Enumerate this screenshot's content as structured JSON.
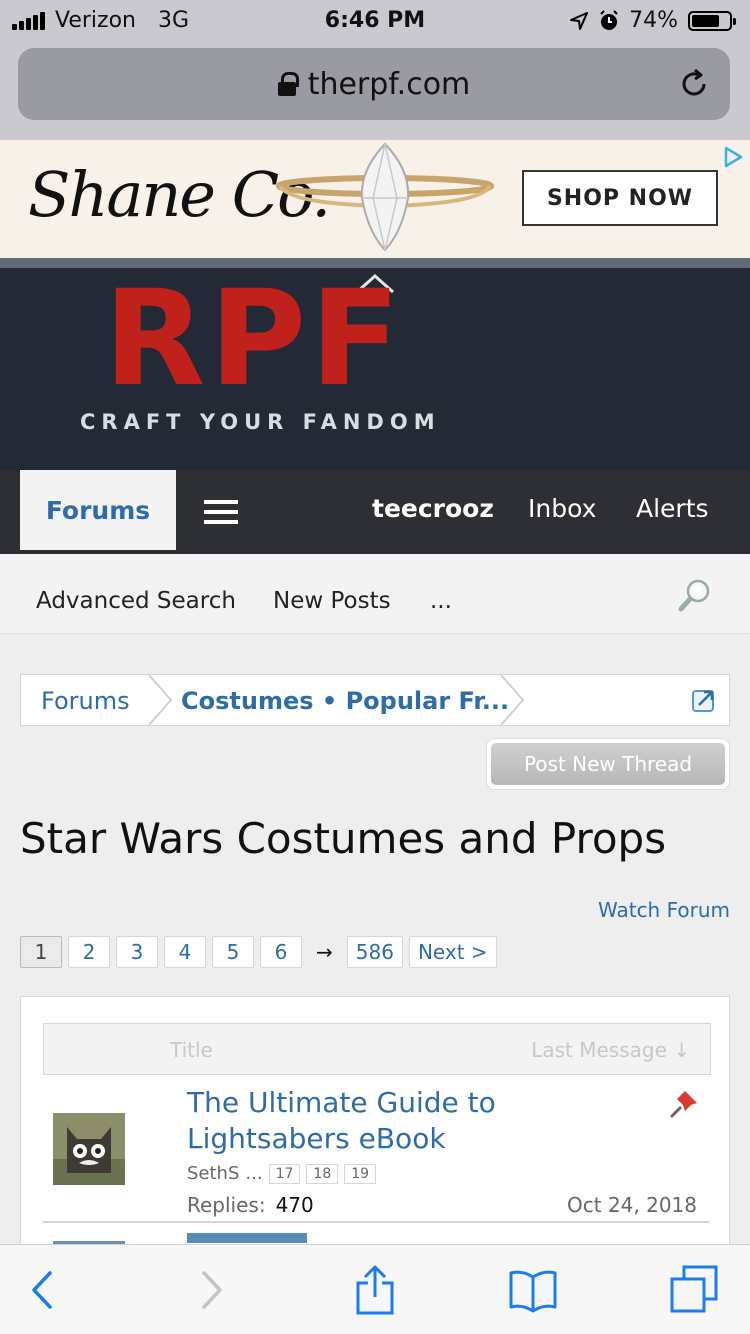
{
  "status_bar": {
    "carrier": "Verizon",
    "network": "3G",
    "time": "6:46 PM",
    "battery_pct": "74%"
  },
  "browser": {
    "url": "therpf.com"
  },
  "ad": {
    "brand": "Shane Co.",
    "cta": "SHOP NOW"
  },
  "site": {
    "logo_text": "RPF",
    "tagline": "CRAFT YOUR FANDOM"
  },
  "nav": {
    "forums": "Forums",
    "user": "teecrooz",
    "inbox": "Inbox",
    "alerts": "Alerts"
  },
  "subnav": {
    "advanced_search": "Advanced Search",
    "new_posts": "New Posts",
    "more": "..."
  },
  "breadcrumb": {
    "items": [
      "Forums",
      "Costumes • Popular Fr..."
    ]
  },
  "actions": {
    "post_new_thread": "Post New Thread",
    "watch_forum": "Watch Forum"
  },
  "page": {
    "title": "Star Wars Costumes and Props"
  },
  "pagination": {
    "pages": [
      "1",
      "2",
      "3",
      "4",
      "5",
      "6"
    ],
    "arrow": "→",
    "last": "586",
    "next": "Next >"
  },
  "thread_list": {
    "columns": {
      "title": "Title",
      "last_message": "Last Message ↓"
    },
    "threads": [
      {
        "title": "The Ultimate Guide to Lightsabers eBook",
        "starter": "SethS",
        "ellipsis": "...",
        "mini_pages": [
          "17",
          "18",
          "19"
        ],
        "replies_label": "Replies:",
        "replies": "470",
        "date": "Oct 24, 2018"
      }
    ]
  },
  "colors": {
    "link": "#2e6ca8",
    "header_bg": "#232a35",
    "logo_red": "#c0221b",
    "nav_bg": "#2d2f33",
    "ios_blue": "#1a7cf0"
  }
}
